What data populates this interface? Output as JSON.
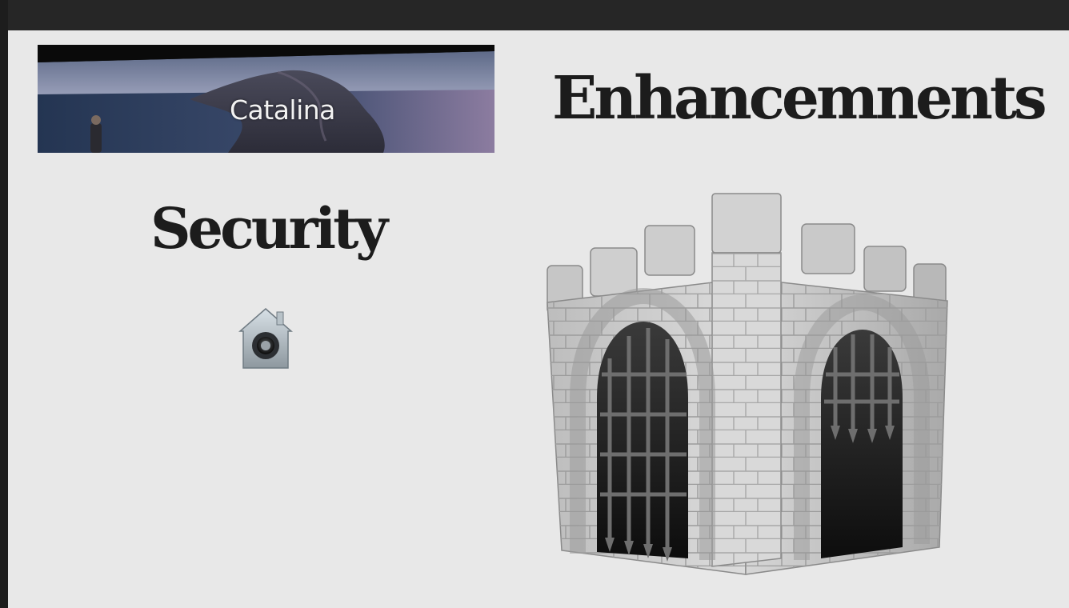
{
  "banner": {
    "caption": "Catalina",
    "image": "macOS Catalina keynote banner"
  },
  "title": "Enhancemnents",
  "subtitle": "Security",
  "icons": {
    "lock": "security-house-lock-icon",
    "gatekeeper": "gatekeeper-castle-icon"
  },
  "colors": {
    "slide_background": "#e8e8e8",
    "top_bar": "#262626",
    "heading_text": "#1c1c1c"
  }
}
